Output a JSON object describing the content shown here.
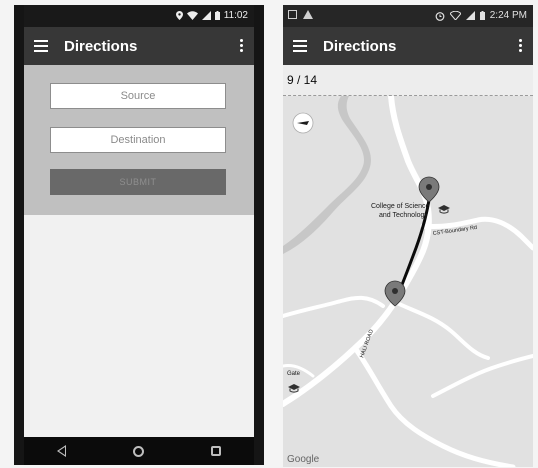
{
  "left_screen": {
    "status_bar": {
      "time": "11:02"
    },
    "app_bar": {
      "title": "Directions"
    },
    "form": {
      "source_placeholder": "Source",
      "destination_placeholder": "Destination",
      "submit_label": "Submit"
    }
  },
  "right_screen": {
    "status_bar": {
      "time": "2:24 PM"
    },
    "app_bar": {
      "title": "Directions"
    },
    "page_counter": "9 / 14",
    "map": {
      "labels": {
        "college_line1": "College of Science",
        "college_line2": "and Technology",
        "road1": "CST-Boundary Rd",
        "road2": "HALI ROAD",
        "gate": "Gate",
        "provider": "Google"
      }
    }
  },
  "icons": [
    "menu-icon",
    "overflow-menu-icon",
    "location-icon",
    "wifi-icon",
    "signal-icon",
    "battery-icon",
    "compass-icon",
    "map-marker-icon",
    "school-icon",
    "back-icon",
    "home-icon",
    "recent-apps-icon",
    "alarm-icon",
    "image-icon",
    "warning-icon"
  ]
}
